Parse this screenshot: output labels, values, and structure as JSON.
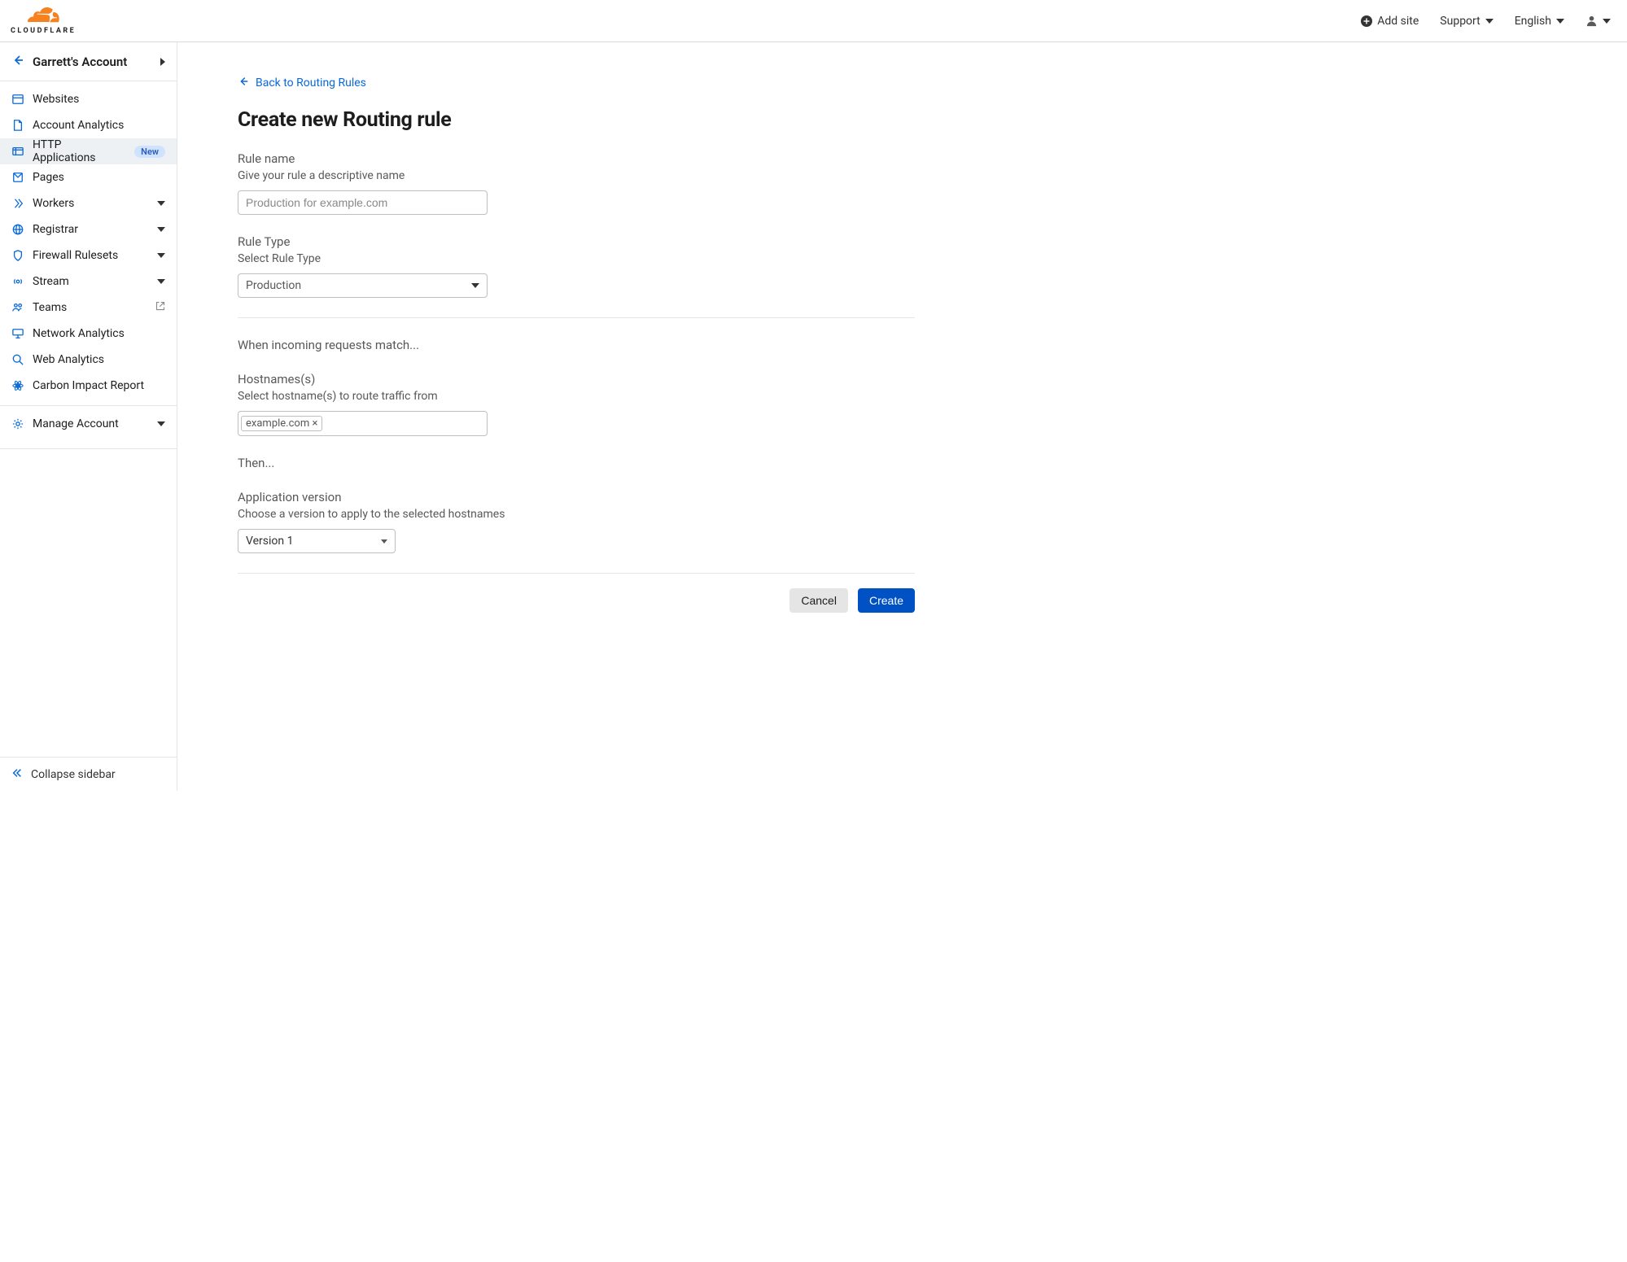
{
  "topbar": {
    "brand": "CLOUDFLARE",
    "add_site": "Add site",
    "support": "Support",
    "language": "English"
  },
  "sidebar": {
    "account": "Garrett's Account",
    "items": [
      {
        "label": "Websites"
      },
      {
        "label": "Account Analytics"
      },
      {
        "label": "HTTP Applications",
        "badge": "New",
        "active": true
      },
      {
        "label": "Pages"
      },
      {
        "label": "Workers",
        "caret": true
      },
      {
        "label": "Registrar",
        "caret": true
      },
      {
        "label": "Firewall Rulesets",
        "caret": true
      },
      {
        "label": "Stream",
        "caret": true
      },
      {
        "label": "Teams",
        "external": true
      },
      {
        "label": "Network Analytics"
      },
      {
        "label": "Web Analytics"
      },
      {
        "label": "Carbon Impact Report"
      }
    ],
    "manage": "Manage Account",
    "collapse": "Collapse sidebar"
  },
  "main": {
    "back": "Back to Routing Rules",
    "title": "Create new Routing rule",
    "rule_name": {
      "heading": "Rule name",
      "help": "Give your rule a descriptive name",
      "placeholder": "Production for example.com"
    },
    "rule_type": {
      "heading": "Rule Type",
      "help": "Select Rule Type",
      "value": "Production"
    },
    "match_heading": "When incoming requests match...",
    "hostnames": {
      "heading": "Hostnames(s)",
      "help": "Select hostname(s) to route traffic from",
      "chip": "example.com ×"
    },
    "then_heading": "Then...",
    "version": {
      "heading": "Application version",
      "help": "Choose a version to apply to the selected hostnames",
      "value": "Version 1"
    },
    "cancel": "Cancel",
    "create": "Create"
  }
}
